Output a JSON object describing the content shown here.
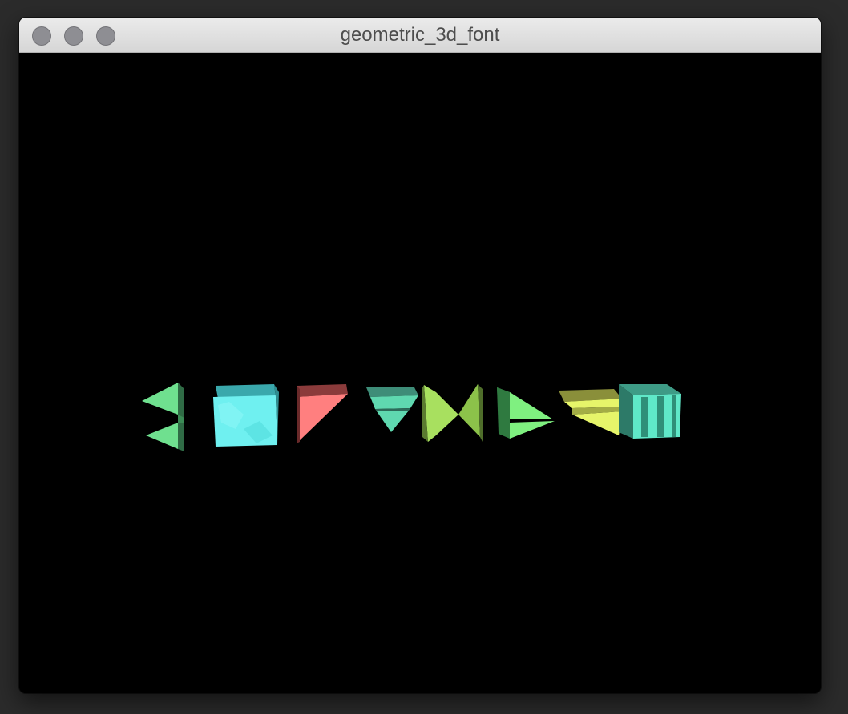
{
  "window": {
    "title": "geometric_3d_font",
    "buttons": {
      "close": "close",
      "minimize": "minimize",
      "zoom": "zoom"
    }
  },
  "scene": {
    "background": "#000000",
    "glyph_colors": {
      "glyph_1": "#6fe08f",
      "glyph_2": "#6ff0f0",
      "glyph_3": "#ff7f7f",
      "glyph_4": "#5fd8b0",
      "glyph_5": "#a8e05f",
      "glyph_6": "#7ff080",
      "glyph_7": "#e6f56a",
      "glyph_8": "#5fe8c8"
    }
  }
}
